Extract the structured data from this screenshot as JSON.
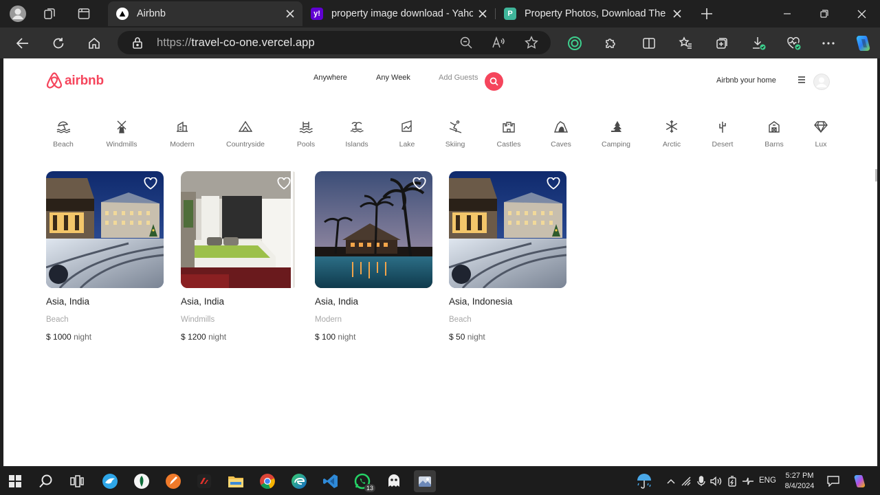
{
  "browser": {
    "tabs": [
      {
        "title": "Airbnb",
        "favicon": "triangle-logo"
      },
      {
        "title": "property image download - Yahoo",
        "favicon": "yahoo-y"
      },
      {
        "title": "Property Photos, Download The F",
        "favicon": "p-square"
      }
    ],
    "url_scheme": "https://",
    "url_host": "travel-co-one.vercel.app"
  },
  "header": {
    "logo_text": "airbnb",
    "search_location": "Anywhere",
    "search_week": "Any Week",
    "search_guests": "Add Guests",
    "host_link": "Airbnb your home"
  },
  "categories": [
    {
      "label": "Beach",
      "icon": "beach-icon"
    },
    {
      "label": "Windmills",
      "icon": "windmill-icon"
    },
    {
      "label": "Modern",
      "icon": "modern-house-icon"
    },
    {
      "label": "Countryside",
      "icon": "mountain-icon"
    },
    {
      "label": "Pools",
      "icon": "pool-icon"
    },
    {
      "label": "Islands",
      "icon": "island-icon"
    },
    {
      "label": "Lake",
      "icon": "lake-icon"
    },
    {
      "label": "Skiing",
      "icon": "skiing-icon"
    },
    {
      "label": "Castles",
      "icon": "castle-icon"
    },
    {
      "label": "Caves",
      "icon": "cave-icon"
    },
    {
      "label": "Camping",
      "icon": "camping-icon"
    },
    {
      "label": "Arctic",
      "icon": "snowflake-icon"
    },
    {
      "label": "Desert",
      "icon": "cactus-icon"
    },
    {
      "label": "Barns",
      "icon": "barn-icon"
    },
    {
      "label": "Lux",
      "icon": "diamond-icon"
    }
  ],
  "listings": [
    {
      "location": "Asia, India",
      "category": "Beach",
      "currency": "$",
      "price": "1000",
      "per": "night"
    },
    {
      "location": "Asia, India",
      "category": "Windmills",
      "currency": "$",
      "price": "1200",
      "per": "night"
    },
    {
      "location": "Asia, India",
      "category": "Modern",
      "currency": "$",
      "price": "100",
      "per": "night"
    },
    {
      "location": "Asia, Indonesia",
      "category": "Beach",
      "currency": "$",
      "price": "50",
      "per": "night"
    }
  ],
  "taskbar": {
    "whatsapp_badge": "13",
    "language": "ENG",
    "time": "5:27 PM",
    "date": "8/4/2024"
  },
  "colors": {
    "brand": "#f5455c",
    "chrome_dark": "#202020",
    "toolbar": "#303030"
  }
}
